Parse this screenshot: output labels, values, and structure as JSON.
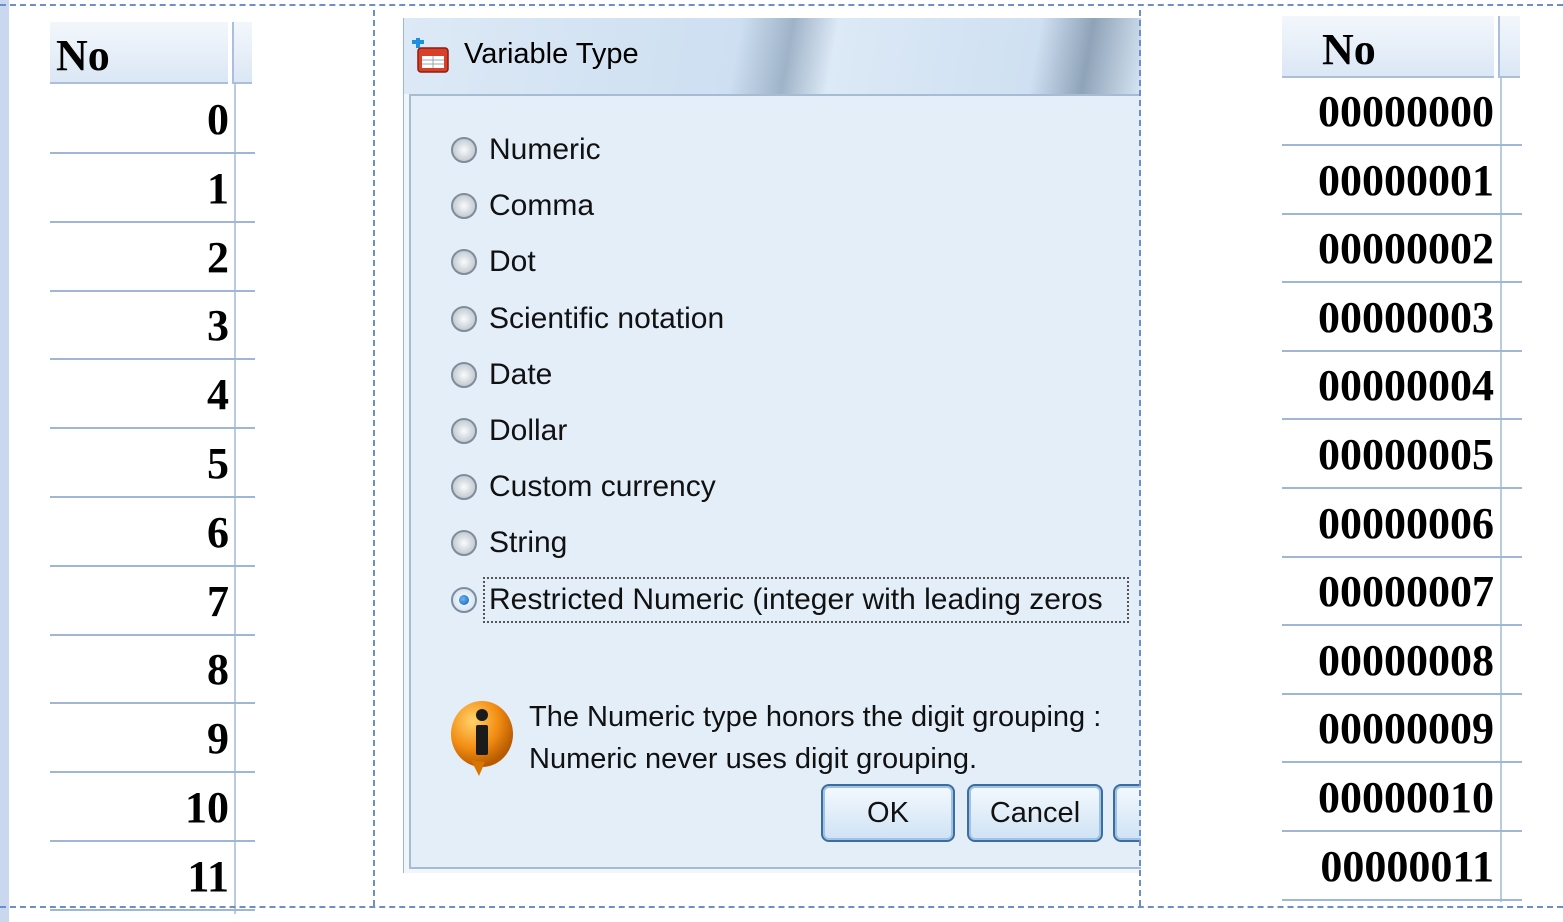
{
  "left_table": {
    "header": "No",
    "rows": [
      "0",
      "1",
      "2",
      "3",
      "4",
      "5",
      "6",
      "7",
      "8",
      "9",
      "10",
      "11"
    ]
  },
  "right_table": {
    "header": "No",
    "rows": [
      "00000000",
      "00000001",
      "00000002",
      "00000003",
      "00000004",
      "00000005",
      "00000006",
      "00000007",
      "00000008",
      "00000009",
      "00000010",
      "00000011"
    ]
  },
  "dialog": {
    "title": "Variable Type",
    "options": [
      {
        "label": "Numeric",
        "checked": false
      },
      {
        "label": "Comma",
        "checked": false
      },
      {
        "label": "Dot",
        "checked": false
      },
      {
        "label": "Scientific notation",
        "checked": false
      },
      {
        "label": "Date",
        "checked": false
      },
      {
        "label": "Dollar",
        "checked": false
      },
      {
        "label": "Custom currency",
        "checked": false
      },
      {
        "label": "String",
        "checked": false
      },
      {
        "label": "Restricted Numeric (integer with leading zeros",
        "checked": true
      }
    ],
    "info_line1": "The Numeric type honors the digit grouping :",
    "info_line2": "Numeric never uses digit grouping.",
    "ok_label": "OK",
    "cancel_label": "Cancel"
  }
}
